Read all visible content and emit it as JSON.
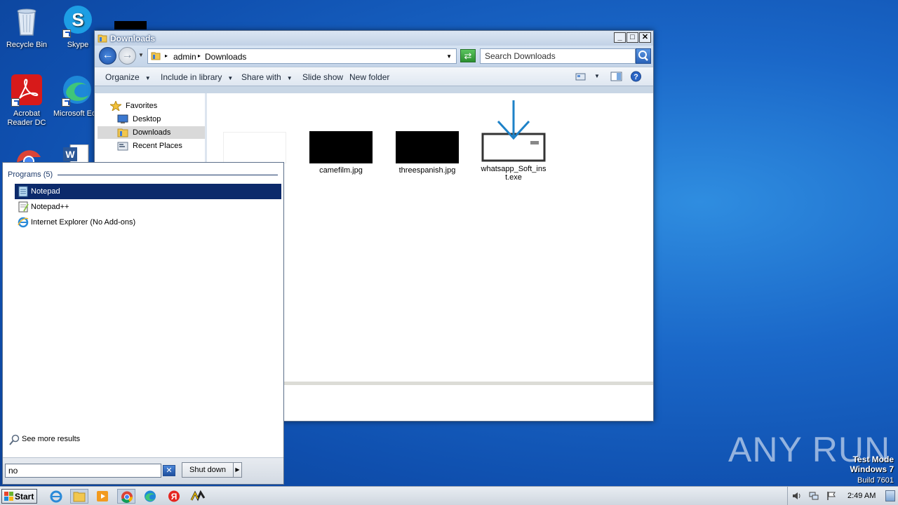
{
  "desktop": {
    "icons": [
      {
        "label": "Recycle Bin"
      },
      {
        "label": "Skype"
      },
      {
        "label": "Acrobat Reader DC"
      },
      {
        "label": "Microsoft Ed"
      }
    ]
  },
  "explorer": {
    "title": "Downloads",
    "breadcrumb": [
      "admin",
      "Downloads"
    ],
    "search_placeholder": "Search Downloads",
    "toolbar": {
      "organize": "Organize",
      "include_in_library": "Include in library",
      "share_with": "Share with",
      "slide_show": "Slide show",
      "new_folder": "New folder"
    },
    "nav": {
      "favorites": "Favorites",
      "items": [
        "Desktop",
        "Downloads",
        "Recent Places"
      ],
      "selected": "Downloads"
    },
    "files": [
      {
        "name": "camefilm.jpg",
        "kind": "image"
      },
      {
        "name": "threespanish.jpg",
        "kind": "image"
      },
      {
        "name": "whatsapp_Soft_inst.exe",
        "line1": "whatsapp_Soft_ins",
        "line2": "t.exe",
        "kind": "installer"
      }
    ]
  },
  "start_menu": {
    "heading": "Programs (5)",
    "programs": [
      {
        "label": "Notepad",
        "icon": "notepad-icon",
        "selected": true
      },
      {
        "label": "Notepad++",
        "icon": "notepadpp-icon",
        "selected": false
      },
      {
        "label": "Internet Explorer (No Add-ons)",
        "icon": "ie-icon",
        "selected": false
      }
    ],
    "see_more": "See more results",
    "search_value": "no",
    "shutdown_label": "Shut down"
  },
  "taskbar": {
    "start_label": "Start",
    "clock": "2:49 AM"
  },
  "watermark": {
    "brand": "ANY RUN",
    "test_mode": "Test Mode",
    "os": "Windows 7",
    "build": "Build 7601"
  },
  "colors": {
    "selection": "#0c2a6b",
    "desktop": "#1a67c8"
  }
}
